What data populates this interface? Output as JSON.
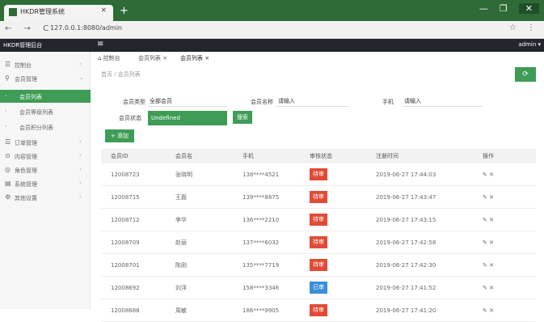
{
  "browser": {
    "tab_title": "HKDR管理系统",
    "tab_close": "×",
    "new_tab": "+",
    "url": "127.0.0.1:8080/admin",
    "nav_buttons": "← → C",
    "window_buttons": [
      "—",
      "❐",
      "✕"
    ]
  },
  "appbar": {
    "brand": "HKDR管理后台",
    "menu": "≡",
    "user": "admin ▾"
  },
  "sidebar": {
    "items": [
      {
        "icon": "☰",
        "label": "控制台",
        "arrow": "›"
      },
      {
        "icon": "⚲",
        "label": "会员管理",
        "arrow": "⌄"
      },
      {
        "icon": "·",
        "label": "会员列表",
        "arrow": ""
      },
      {
        "icon": "·",
        "label": "会员等级列表",
        "arrow": ""
      },
      {
        "icon": "·",
        "label": "会员积分列表",
        "arrow": ""
      },
      {
        "icon": "☰",
        "label": "订单管理",
        "arrow": "›"
      },
      {
        "icon": "⊙",
        "label": "内容管理",
        "arrow": "›"
      },
      {
        "icon": "◎",
        "label": "角色管理",
        "arrow": "›"
      },
      {
        "icon": "▤",
        "label": "系统管理",
        "arrow": "›"
      },
      {
        "icon": "⚙",
        "label": "其他设置",
        "arrow": "›"
      }
    ]
  },
  "tabs": {
    "home": "⌂ 控制台",
    "t1": "会员列表 ×",
    "t2": "会员列表 ×"
  },
  "breadcrumb": "首页 / 会员列表",
  "refresh_label": "⟳",
  "filters": {
    "f1_label": "会员类型",
    "f1_value": "全部会员",
    "f2_label": "会员名称",
    "f2_value": "请输入",
    "f3_label": "手机",
    "f3_value": "请输入",
    "f4_label": "会员状态",
    "dropdown_value": "Undefined",
    "search": "搜索"
  },
  "add_button": "+ 添加",
  "table": {
    "headers": [
      "会员ID",
      "会员名",
      "手机",
      "审核状态",
      "注册时间",
      "操作"
    ],
    "rows": [
      [
        "12008723",
        "张晓明",
        "138****4521",
        "待审",
        "2019-06-27 17:44:03",
        "✎ ✕"
      ],
      [
        "12008715",
        "王磊",
        "139****8875",
        "待审",
        "2019-06-27 17:43:47",
        "✎ ✕"
      ],
      [
        "12008712",
        "李华",
        "136****2210",
        "待审",
        "2019-06-27 17:43:15",
        "✎ ✕"
      ],
      [
        "12008709",
        "赵丽",
        "137****6032",
        "待审",
        "2019-06-27 17:42:58",
        "✎ ✕"
      ],
      [
        "12008701",
        "陈刚",
        "135****7719",
        "待审",
        "2019-06-27 17:42:30",
        "✎ ✕"
      ],
      [
        "12008692",
        "刘洋",
        "158****3346",
        "已审",
        "2019-06-27 17:41:52",
        "✎ ✕"
      ],
      [
        "12008688",
        "周敏",
        "186****9905",
        "待审",
        "2019-06-27 17:41:20",
        "✎ ✕"
      ]
    ],
    "badge_colors": [
      "red",
      "red",
      "red",
      "red",
      "red",
      "blue",
      "red"
    ]
  },
  "colors": {
    "accent": "#3e9c56",
    "danger": "#e14b35",
    "info": "#3b8fd9"
  }
}
